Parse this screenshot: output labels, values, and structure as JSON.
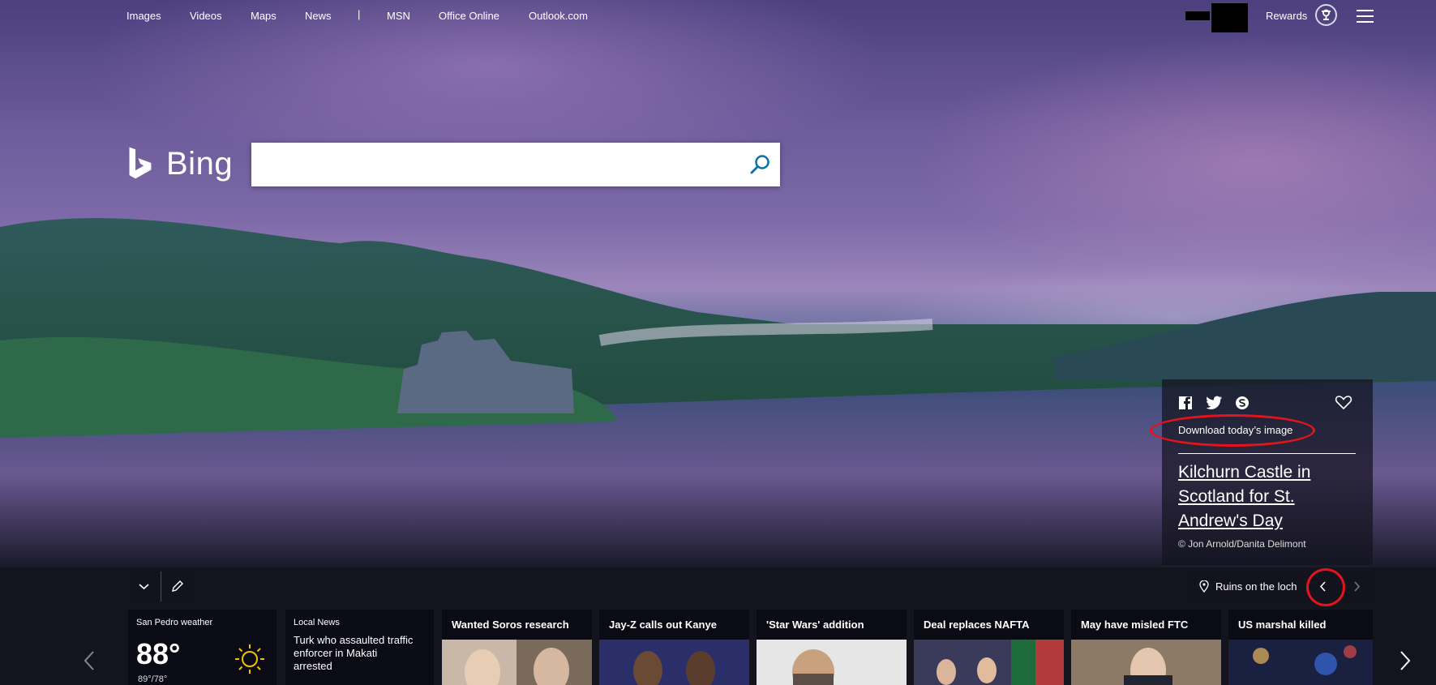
{
  "topnav": {
    "links": [
      "Images",
      "Videos",
      "Maps",
      "News"
    ],
    "separator": "|",
    "links2": [
      "MSN",
      "Office Online",
      "Outlook.com"
    ],
    "rewards_label": "Rewards"
  },
  "brand": {
    "name": "Bing"
  },
  "search": {
    "value": "",
    "placeholder": ""
  },
  "image_info": {
    "download_label": "Download today’s image",
    "title": "Kilchurn Castle in Scotland for St. Andrew's Day",
    "copyright": "© Jon Arnold/Danita Delimont",
    "location_label": "Ruins on the loch"
  },
  "annotations": {
    "highlight_color": "#e3141b"
  },
  "weather": {
    "label": "San Pedro weather",
    "temp": "88°",
    "range": "89°/78°",
    "icon": "sun-icon"
  },
  "local_news": {
    "label": "Local News",
    "headline": "Turk who assaulted traffic enforcer in Makati arrested"
  },
  "news": [
    {
      "title": "Wanted Soros research"
    },
    {
      "title": "Jay-Z calls out Kanye"
    },
    {
      "title": "'Star Wars' addition"
    },
    {
      "title": "Deal replaces NAFTA"
    },
    {
      "title": "May have misled FTC"
    },
    {
      "title": "US marshal killed"
    }
  ]
}
